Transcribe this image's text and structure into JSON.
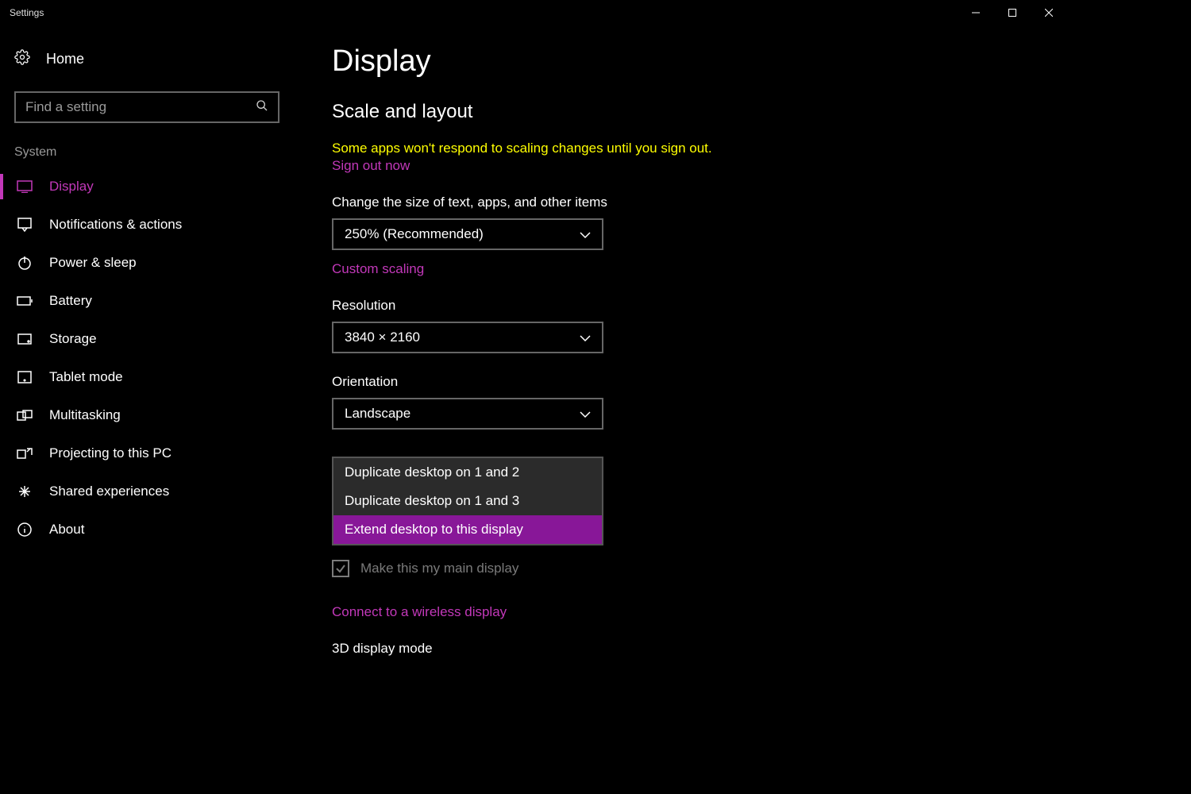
{
  "titlebar": {
    "title": "Settings"
  },
  "sidebar": {
    "home_label": "Home",
    "search_placeholder": "Find a setting",
    "category": "System",
    "items": [
      {
        "label": "Display"
      },
      {
        "label": "Notifications & actions"
      },
      {
        "label": "Power & sleep"
      },
      {
        "label": "Battery"
      },
      {
        "label": "Storage"
      },
      {
        "label": "Tablet mode"
      },
      {
        "label": "Multitasking"
      },
      {
        "label": "Projecting to this PC"
      },
      {
        "label": "Shared experiences"
      },
      {
        "label": "About"
      }
    ]
  },
  "main": {
    "title": "Display",
    "section": "Scale and layout",
    "warning": "Some apps won't respond to scaling changes until you sign out.",
    "sign_out": "Sign out now",
    "scale_label": "Change the size of text, apps, and other items",
    "scale_value": "250% (Recommended)",
    "custom_scaling": "Custom scaling",
    "resolution_label": "Resolution",
    "resolution_value": "3840 × 2160",
    "orientation_label": "Orientation",
    "orientation_value": "Landscape",
    "multi_options": [
      "Duplicate desktop on 1 and 2",
      "Duplicate desktop on 1 and 3",
      "Extend desktop to this display"
    ],
    "main_display_label": "Make this my main display",
    "wireless_link": "Connect to a wireless display",
    "threeD_label": "3D display mode"
  }
}
